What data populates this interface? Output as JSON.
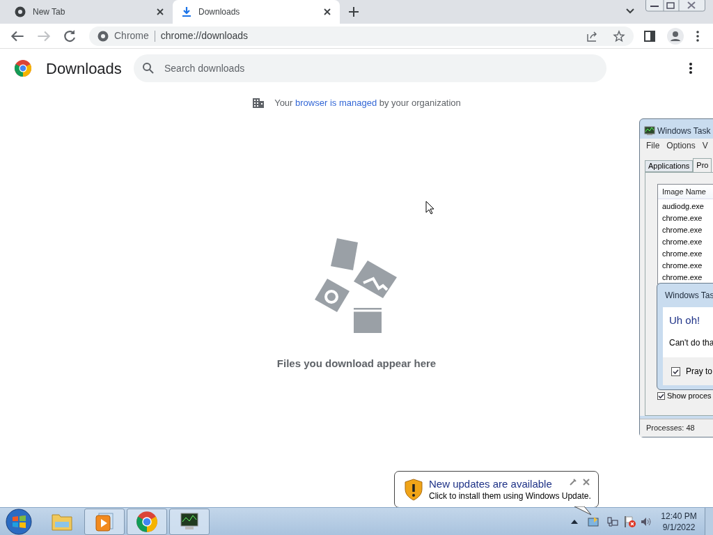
{
  "tabs": [
    {
      "title": "New Tab",
      "selected": false
    },
    {
      "title": "Downloads",
      "selected": true
    }
  ],
  "address": {
    "site": "Chrome",
    "url": "chrome://downloads"
  },
  "page": {
    "title": "Downloads",
    "search_placeholder": "Search downloads",
    "notice": {
      "before": "Your",
      "link": "browser is managed",
      "after": "by your organization"
    },
    "empty_message": "Files you download appear here"
  },
  "task_manager": {
    "title": "Windows Task",
    "menu": [
      "File",
      "Options",
      "V"
    ],
    "tabs": [
      {
        "label": "Applications",
        "selected": false
      },
      {
        "label": "Pro",
        "selected": true
      }
    ],
    "column": "Image Name",
    "rows": [
      "audiodg.exe",
      "chrome.exe",
      "chrome.exe",
      "chrome.exe",
      "chrome.exe",
      "chrome.exe",
      "chrome.exe"
    ],
    "show_processes": {
      "label": "Show proces",
      "checked": true
    },
    "status": "Processes: 48"
  },
  "dialog": {
    "title": "Windows Tas",
    "heading": "Uh oh!",
    "message": "Can't do tha",
    "checkbox": {
      "label": "Pray to",
      "checked": true
    }
  },
  "balloon": {
    "title": "New updates are available",
    "message": "Click to install them using Windows Update."
  },
  "taskbar": {
    "apps": [
      {
        "kind": "explorer",
        "active": false
      },
      {
        "kind": "media",
        "active": true
      },
      {
        "kind": "chrome",
        "active": true
      },
      {
        "kind": "taskmgr",
        "active": true
      }
    ],
    "time": "12:40 PM",
    "date": "9/1/2022"
  }
}
